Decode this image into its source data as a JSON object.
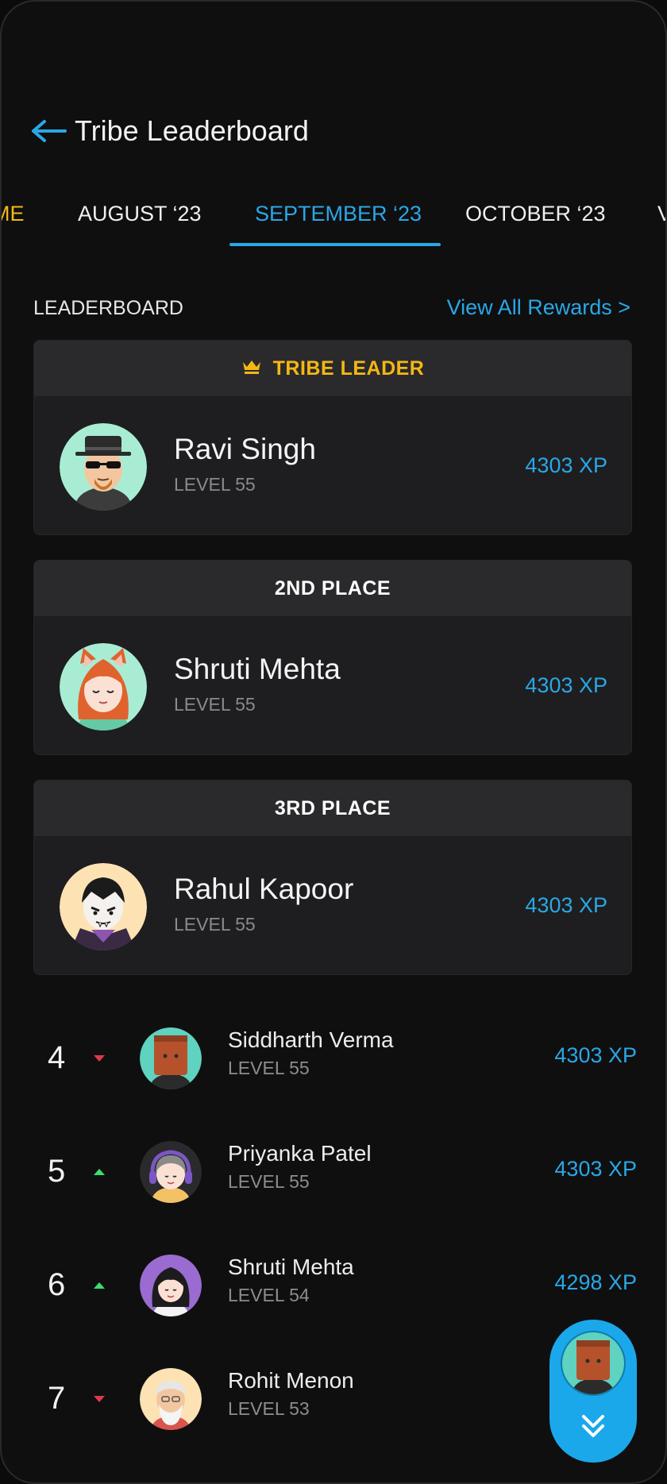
{
  "header": {
    "title": "Tribe Leaderboard"
  },
  "tabs": [
    {
      "label": "ME"
    },
    {
      "label": "AUGUST ‘23"
    },
    {
      "label": "SEPTEMBER ‘23",
      "active": true
    },
    {
      "label": "OCTOBER ‘23"
    },
    {
      "label": "V"
    }
  ],
  "section": {
    "label": "LEADERBOARD",
    "rewards_link": "View All Rewards >"
  },
  "podium": [
    {
      "place": "TRIBE LEADER",
      "name": "Ravi Singh",
      "level": "LEVEL 55",
      "xp": "4303 XP",
      "avatar": "man-hat-sunglasses-avatar"
    },
    {
      "place": "2ND PLACE",
      "name": "Shruti Mehta",
      "level": "LEVEL 55",
      "xp": "4303 XP",
      "avatar": "girl-cat-ears-avatar"
    },
    {
      "place": "3RD PLACE",
      "name": "Rahul Kapoor",
      "level": "LEVEL 55",
      "xp": "4303 XP",
      "avatar": "vampire-avatar"
    }
  ],
  "ranks": [
    {
      "rank": "4",
      "trend": "down",
      "name": "Siddharth Verma",
      "level": "LEVEL 55",
      "xp": "4303 XP",
      "avatar": "box-head-avatar"
    },
    {
      "rank": "5",
      "trend": "up",
      "name": "Priyanka Patel",
      "level": "LEVEL 55",
      "xp": "4303 XP",
      "avatar": "headphones-avatar"
    },
    {
      "rank": "6",
      "trend": "up",
      "name": "Shruti Mehta",
      "level": "LEVEL 54",
      "xp": "4298 XP",
      "avatar": "dark-hair-girl-avatar"
    },
    {
      "rank": "7",
      "trend": "down",
      "name": "Rohit Menon",
      "level": "LEVEL 53",
      "xp": "",
      "avatar": "old-man-avatar"
    }
  ],
  "colors": {
    "accent": "#2aa7e6",
    "gold": "#f5b715",
    "up": "#3ddc6b",
    "down": "#e0384a",
    "background": "#0f0f10",
    "card": "#1e1e20"
  },
  "icons": {
    "back": "back-arrow-icon",
    "crown": "crown-icon",
    "scroll_down": "double-chevron-down-icon"
  }
}
